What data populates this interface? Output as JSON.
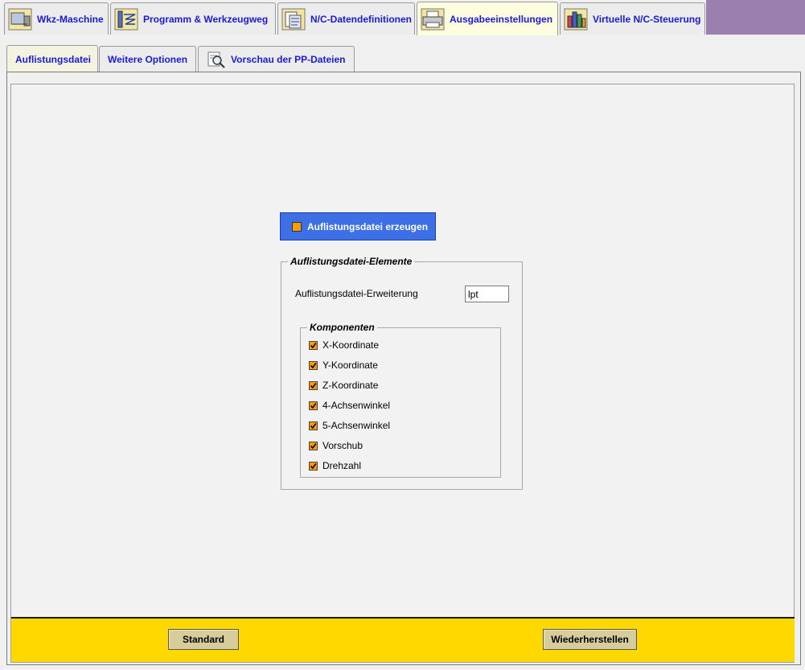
{
  "top_tabs": [
    {
      "label": "Wkz-Maschine",
      "icon": "machine-tool-icon",
      "selected": false
    },
    {
      "label": "Programm & Werkzeugweg",
      "icon": "toolpath-icon",
      "selected": false
    },
    {
      "label": "N/C-Datendefinitionen",
      "icon": "nc-data-icon",
      "selected": false
    },
    {
      "label": "Ausgabeeinstellungen",
      "icon": "printer-icon",
      "selected": true
    },
    {
      "label": "Virtuelle N/C-Steuerung",
      "icon": "virtual-controller-icon",
      "selected": false
    }
  ],
  "sub_tabs": [
    {
      "label": "Auflistungsdatei",
      "selected": true
    },
    {
      "label": "Weitere Optionen",
      "selected": false
    },
    {
      "label": "Vorschau der PP-Dateien",
      "icon": "magnifier-icon",
      "selected": false
    }
  ],
  "toggle": {
    "label": "Auflistungsdatei erzeugen"
  },
  "elements_group": {
    "legend": "Auflistungsdatei-Elemente",
    "extension_label": "Auflistungsdatei-Erweiterung",
    "extension_value": "lpt"
  },
  "components_group": {
    "legend": "Komponenten",
    "items": [
      {
        "label": "X-Koordinate",
        "checked": true
      },
      {
        "label": "Y-Koordinate",
        "checked": true
      },
      {
        "label": "Z-Koordinate",
        "checked": true
      },
      {
        "label": "4-Achsenwinkel",
        "checked": true
      },
      {
        "label": "5-Achsenwinkel",
        "checked": true
      },
      {
        "label": "Vorschub",
        "checked": true
      },
      {
        "label": "Drehzahl",
        "checked": true
      }
    ]
  },
  "footer": {
    "standard_label": "Standard",
    "restore_label": "Wiederherstellen"
  },
  "colors": {
    "accent": "#3d6fe6",
    "footer": "#ffd800",
    "checkbox": "#ff9a00",
    "tab_text": "#1a1adc"
  }
}
